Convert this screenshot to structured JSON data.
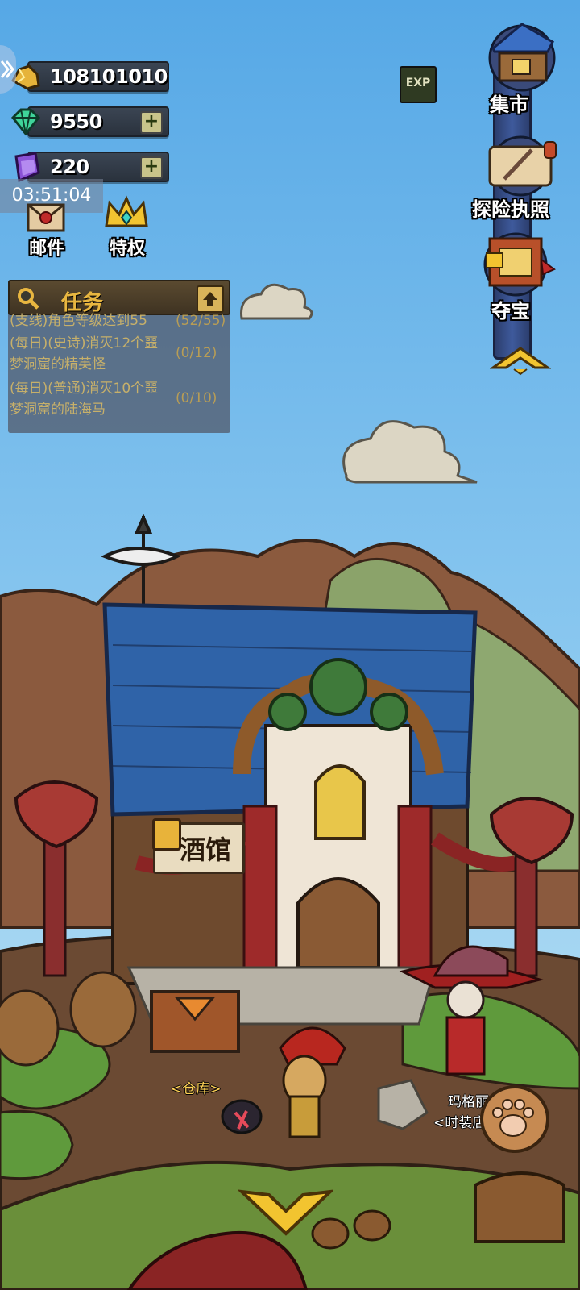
{
  "currencies": {
    "gold": "108101010",
    "gems": "9550",
    "crystals": "220",
    "add_symbol": "+"
  },
  "timer": "03:51:04",
  "top_left_buttons": {
    "mail": "邮件",
    "privilege": "特权"
  },
  "quest_panel": {
    "title": "任务",
    "items": [
      {
        "text": "(支线)角色等级达到55",
        "progress": "(52/55)"
      },
      {
        "text": "(每日)(史诗)消灭12个噩梦洞窟的精英怪",
        "progress": "(0/12)"
      },
      {
        "text": "(每日)(普通)消灭10个噩梦洞窟的陆海马",
        "progress": "(0/10)"
      }
    ]
  },
  "exp_button": "EXP",
  "right_menu": {
    "market": "集市",
    "license": "探险执照",
    "treasure": "夺宝"
  },
  "scene": {
    "tavern_sign": "酒馆",
    "warehouse_tag": "<仓库>",
    "npc_name": "玛格丽",
    "fashion_tag": "<时装店"
  },
  "colors": {
    "sky_top": "#56a8e6",
    "sky_bottom": "#c4e6f4",
    "roof_blue": "#2f63a8",
    "ground": "#6b4a33",
    "grass": "#5f9a3c",
    "quest_gold": "#e8b640"
  }
}
